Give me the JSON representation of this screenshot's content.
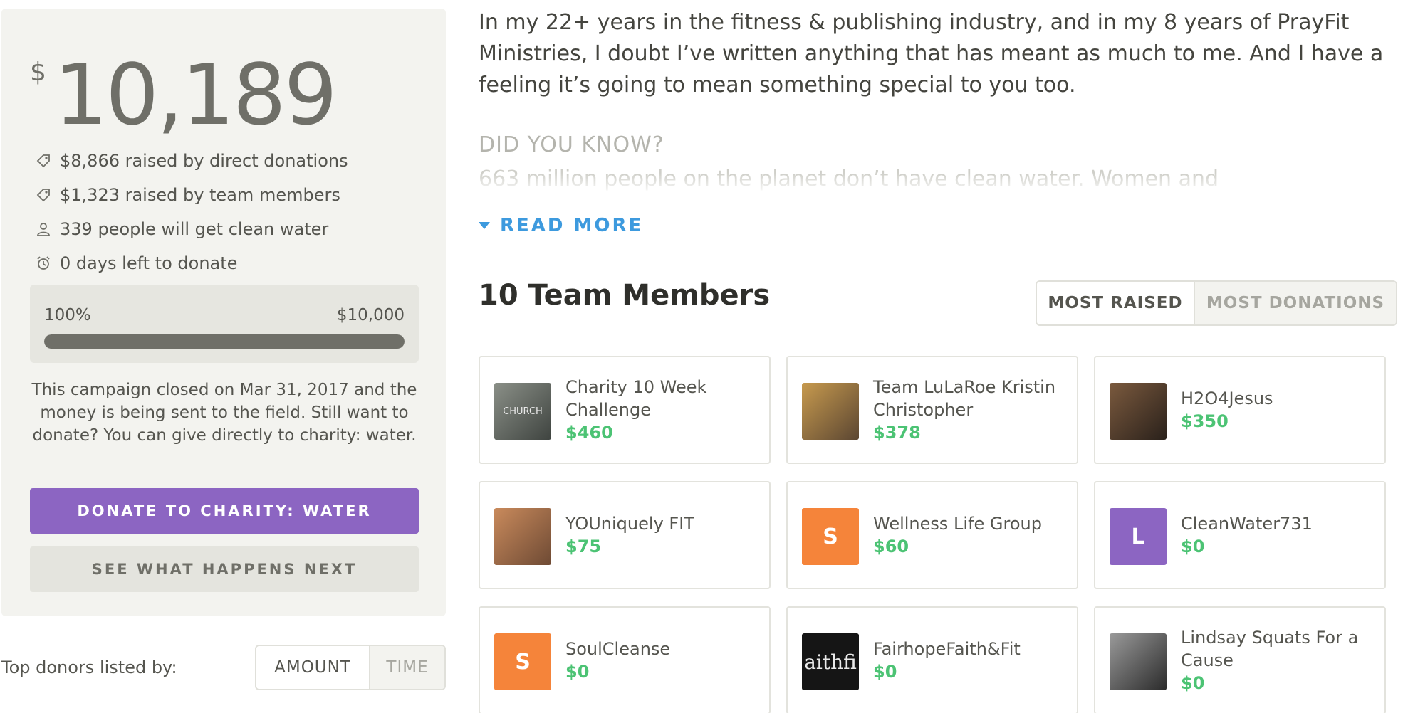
{
  "campaign": {
    "currency_symbol": "$",
    "total_raised": "10,189",
    "stats": [
      {
        "icon": "tag-icon",
        "text": "$8,866 raised by direct donations"
      },
      {
        "icon": "tag-icon",
        "text": "$1,323 raised by team members"
      },
      {
        "icon": "person-icon",
        "text": "339 people will get clean water"
      },
      {
        "icon": "alarm-clock-icon",
        "text": "0 days left to donate"
      }
    ],
    "progress": {
      "percent_label": "100%",
      "goal_label": "$10,000",
      "fraction": 1.0
    },
    "closed_message": "This campaign closed on Mar 31, 2017 and the money is being sent to the field. Still want to donate? You can give directly to charity: water.",
    "donate_button": "DONATE TO CHARITY: WATER",
    "next_button": "SEE WHAT HAPPENS NEXT"
  },
  "donors": {
    "label": "Top donors listed by:",
    "sort_options": [
      "AMOUNT",
      "TIME"
    ],
    "active": "AMOUNT"
  },
  "story": {
    "paragraph": "In my 22+ years in the fitness & publishing industry, and in my 8 years of PrayFit Ministries, I doubt I’ve written anything that has meant as much to me. And I have a feeling it’s going to mean something special to you too.",
    "did_you_know": "DID YOU KNOW?",
    "faded_line": "663 million people on the planet don’t have clean water. Women and",
    "read_more": "READ MORE"
  },
  "team": {
    "heading": "10 Team Members",
    "sort_options": [
      "MOST RAISED",
      "MOST DONATIONS"
    ],
    "active": "MOST RAISED",
    "members": [
      {
        "name": "Charity 10 Week Challenge",
        "amount": "$460",
        "avatar": {
          "type": "photo",
          "colors": [
            "#8a8f87",
            "#3f4440"
          ],
          "label": "CHURCH"
        }
      },
      {
        "name": "Team LuLaRoe Kristin Christopher",
        "amount": "$378",
        "avatar": {
          "type": "photo",
          "colors": [
            "#c79a4e",
            "#5b4632"
          ],
          "label": ""
        }
      },
      {
        "name": "H2O4Jesus",
        "amount": "$350",
        "avatar": {
          "type": "photo",
          "colors": [
            "#7b5a3e",
            "#2a211b"
          ],
          "label": ""
        }
      },
      {
        "name": "YOUniquely FIT",
        "amount": "$75",
        "avatar": {
          "type": "photo",
          "colors": [
            "#c98a5c",
            "#6e4a34"
          ],
          "label": ""
        }
      },
      {
        "name": "Wellness Life Group",
        "amount": "$60",
        "avatar": {
          "type": "initial",
          "letter": "S",
          "color": "#f5843a"
        }
      },
      {
        "name": "CleanWater731",
        "amount": "$0",
        "avatar": {
          "type": "initial",
          "letter": "L",
          "color": "#8c65c2"
        }
      },
      {
        "name": "SoulCleanse",
        "amount": "$0",
        "avatar": {
          "type": "initial",
          "letter": "S",
          "color": "#f5843a"
        }
      },
      {
        "name": "FairhopeFaith&Fit",
        "amount": "$0",
        "avatar": {
          "type": "logo",
          "colors": [
            "#151515",
            "#151515"
          ],
          "label": "aithfi"
        }
      },
      {
        "name": "Lindsay Squats For a Cause",
        "amount": "$0",
        "avatar": {
          "type": "photo",
          "colors": [
            "#9a9a9a",
            "#2b2b2b"
          ],
          "label": ""
        }
      }
    ]
  }
}
